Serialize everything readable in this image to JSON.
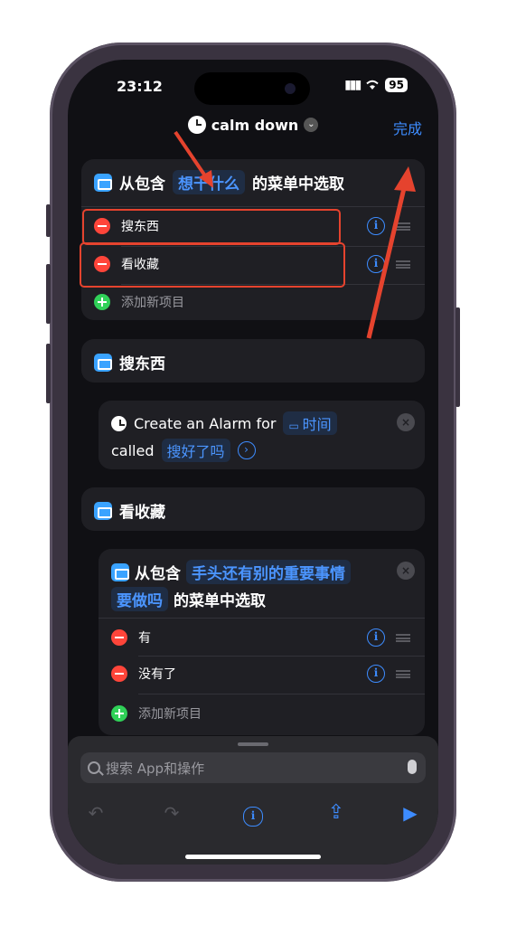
{
  "status": {
    "time": "23:12",
    "battery": "95"
  },
  "nav": {
    "title": "calm down",
    "done_label": "完成"
  },
  "menu_card": {
    "prefix": "从包含",
    "token": "想干什么",
    "suffix": "的菜单中选取",
    "items": [
      "搜东西",
      "看收藏"
    ],
    "add_label": "添加新项目"
  },
  "section1": {
    "title": "搜东西"
  },
  "alarm_card": {
    "line1": "Create an Alarm for",
    "token_time": "时间",
    "called": "called",
    "token_name": "搜好了吗"
  },
  "section2": {
    "title": "看收藏"
  },
  "nested_menu": {
    "prefix": "从包含",
    "token_line1": "手头还有别的重要事情",
    "token_line2": "要做吗",
    "suffix": "的菜单中选取",
    "items": [
      "有",
      "没有了"
    ],
    "add_label": "添加新项目"
  },
  "search": {
    "placeholder": "搜索 App和操作"
  },
  "colors": {
    "accent": "#3d8cff",
    "danger": "#ff453a",
    "success": "#30d158",
    "annotation": "#e5432e"
  }
}
